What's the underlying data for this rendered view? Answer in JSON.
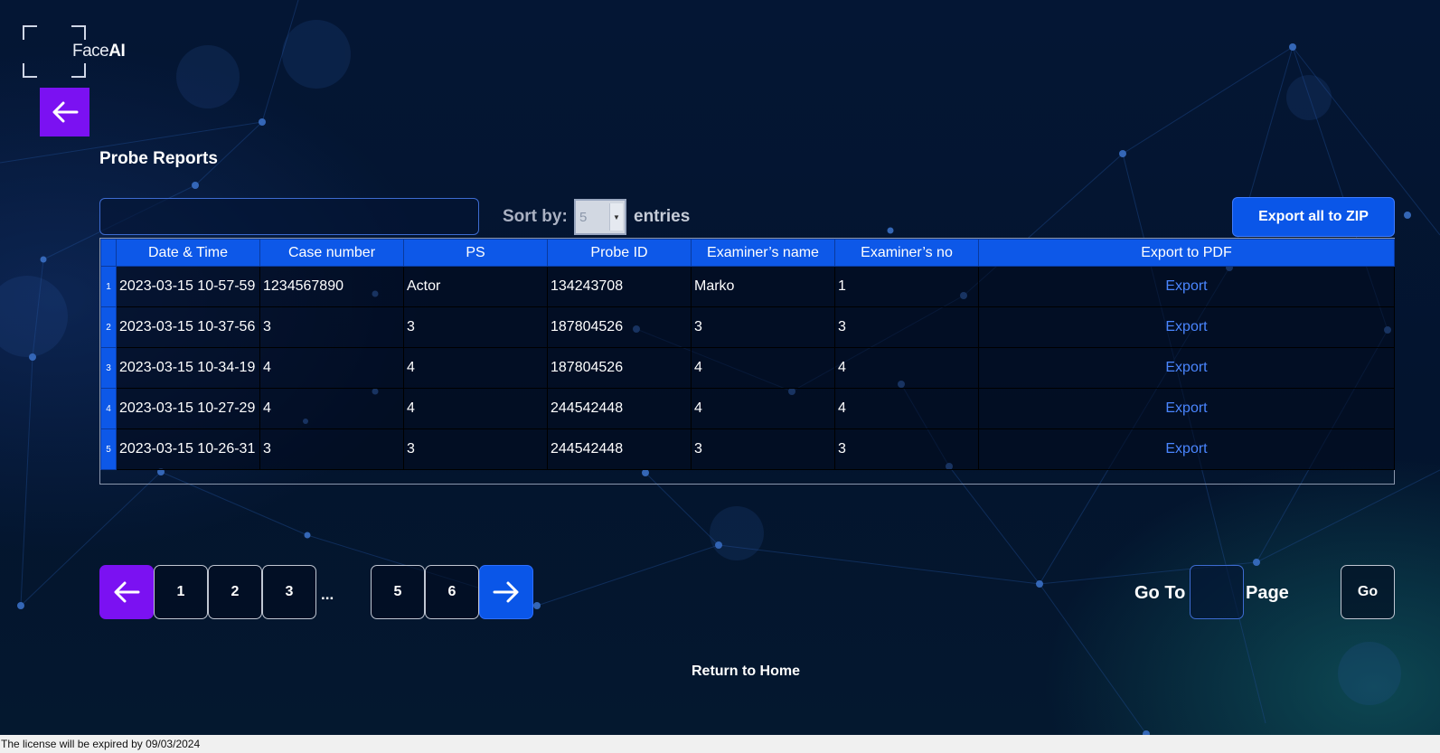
{
  "logo": {
    "light": "Face",
    "bold": "AI"
  },
  "page_title": "Probe Reports",
  "search": {
    "value": "",
    "placeholder": ""
  },
  "sort": {
    "label": "Sort by:",
    "value": "5",
    "suffix": "entries"
  },
  "export_all_label": "Export all to ZIP",
  "table": {
    "headers": [
      "Date & Time",
      "Case number",
      "PS",
      "Probe ID",
      "Examiner’s name",
      "Examiner’s no",
      "Export to PDF"
    ],
    "rows": [
      {
        "index": "1",
        "datetime": "2023-03-15 10-57-59",
        "case_number": "1234567890",
        "ps": "Actor",
        "probe_id": "134243708",
        "examiner_name": "Marko",
        "examiner_no": "1",
        "export": "Export"
      },
      {
        "index": "2",
        "datetime": "2023-03-15 10-37-56",
        "case_number": "3",
        "ps": "3",
        "probe_id": "187804526",
        "examiner_name": "3",
        "examiner_no": "3",
        "export": "Export"
      },
      {
        "index": "3",
        "datetime": "2023-03-15 10-34-19",
        "case_number": "4",
        "ps": "4",
        "probe_id": "187804526",
        "examiner_name": "4",
        "examiner_no": "4",
        "export": "Export"
      },
      {
        "index": "4",
        "datetime": "2023-03-15 10-27-29",
        "case_number": "4",
        "ps": "4",
        "probe_id": "244542448",
        "examiner_name": "4",
        "examiner_no": "4",
        "export": "Export"
      },
      {
        "index": "5",
        "datetime": "2023-03-15 10-26-31",
        "case_number": "3",
        "ps": "3",
        "probe_id": "244542448",
        "examiner_name": "3",
        "examiner_no": "3",
        "export": "Export"
      }
    ]
  },
  "pagination": {
    "prev_icon": "arrow-left-icon",
    "pages": [
      "1",
      "2",
      "3",
      "...",
      "5",
      "6"
    ],
    "next_icon": "arrow-right-icon"
  },
  "goto": {
    "label": "Go To",
    "value": "",
    "page_label": "Page",
    "button": "Go"
  },
  "return_home": "Return to Home",
  "license": "The license will be expired by 09/03/2024",
  "colors": {
    "accent_purple": "#7b11f2",
    "accent_blue": "#0a56e8",
    "link_blue": "#4a86ff",
    "background": "#041634"
  }
}
